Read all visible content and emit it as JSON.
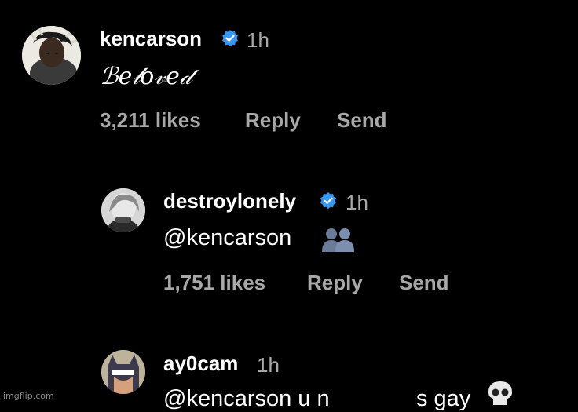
{
  "colors": {
    "background": "#000000",
    "username": "#ffffff",
    "secondary": "#a8a8a8",
    "verified_badge": "#3897f0"
  },
  "comments": [
    {
      "username": "kencarson",
      "verified": true,
      "time": "1h",
      "text": "ℬ𝑒𝓁𝑜𝓋𝑒𝒹",
      "likes": "3,211 likes",
      "reply_label": "Reply",
      "send_label": "Send"
    },
    {
      "username": "destroylonely",
      "verified": true,
      "time": "1h",
      "text": "@kencarson",
      "emoji_icon": "busts-in-silhouette-icon",
      "likes": "1,751 likes",
      "reply_label": "Reply",
      "send_label": "Send"
    },
    {
      "username": "ay0cam",
      "verified": false,
      "time": "1h",
      "text": "@kencarson u n",
      "text_tail": "s gay",
      "emoji_icon": "skull-icon"
    }
  ],
  "watermark": "imgflip.com"
}
